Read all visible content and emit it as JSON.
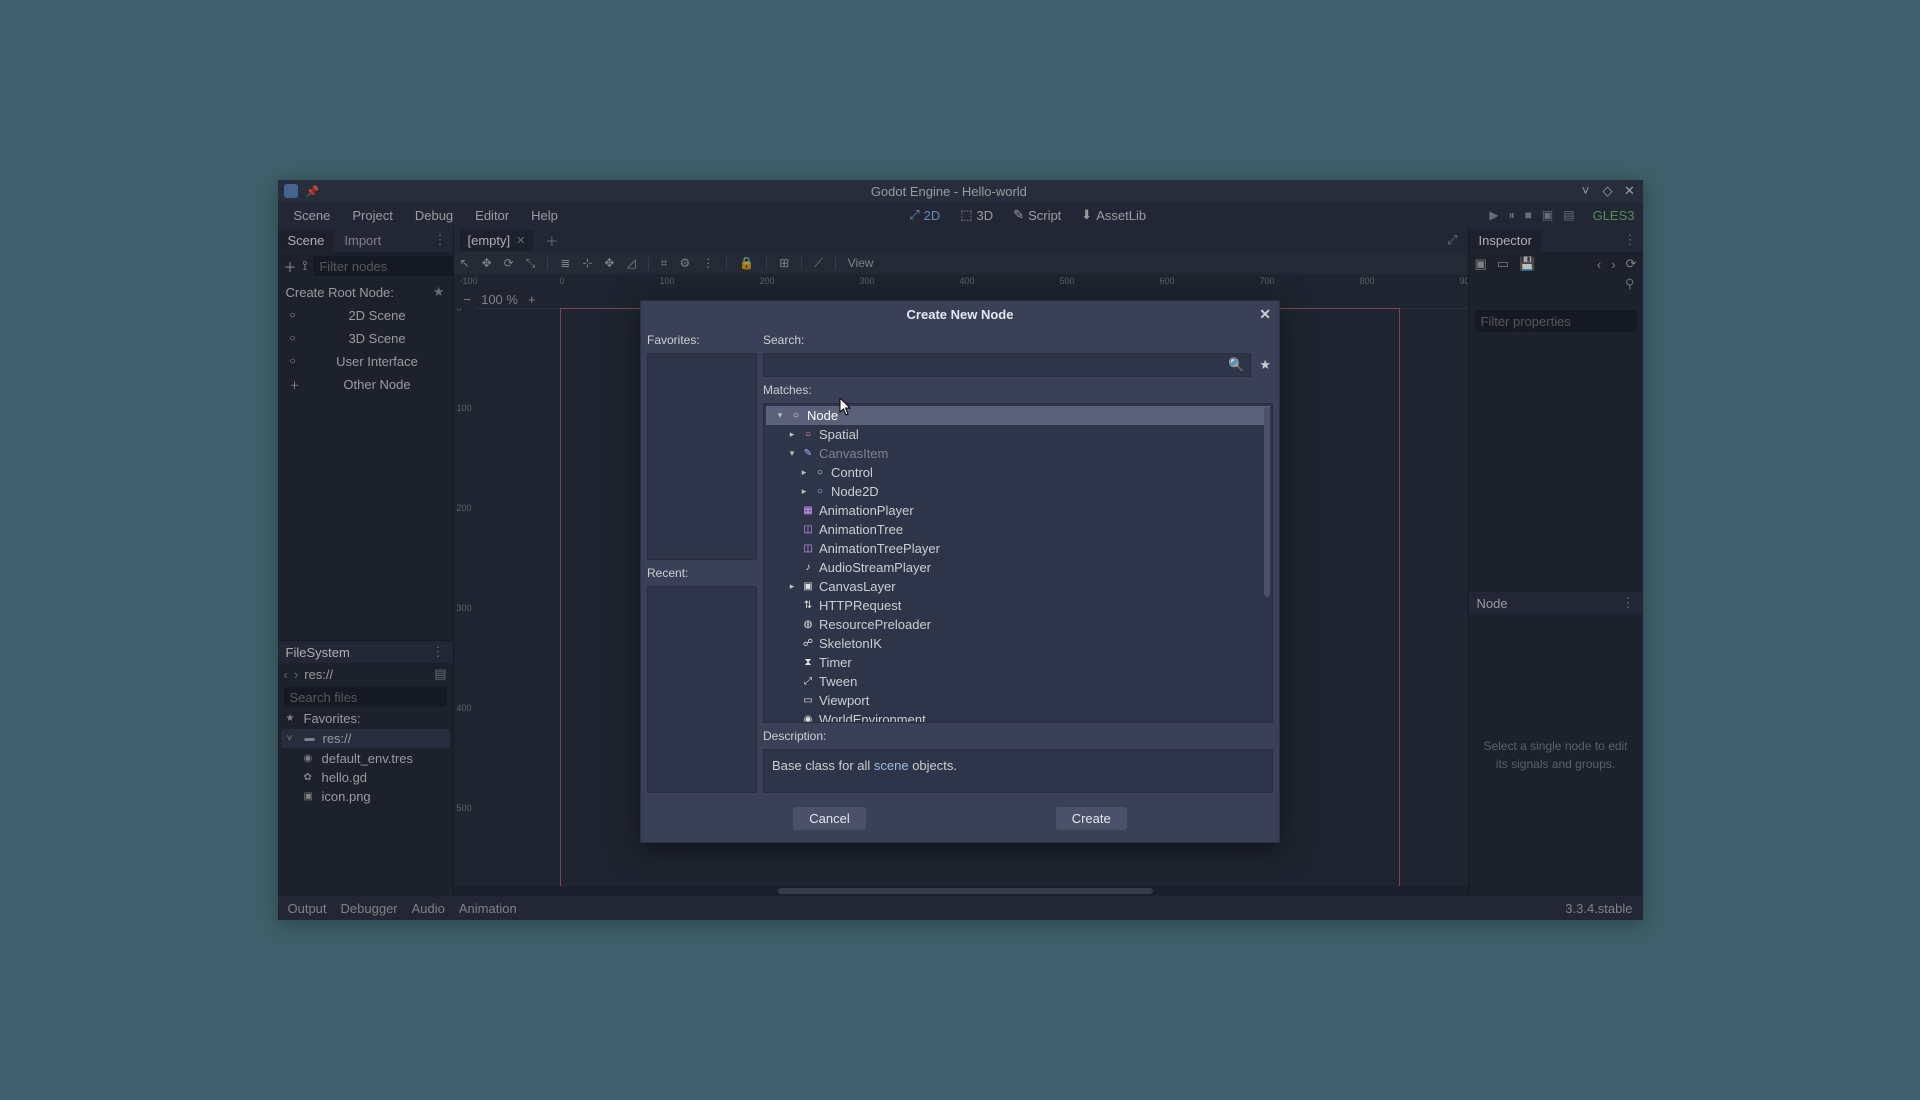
{
  "titlebar": {
    "title": "Godot Engine - Hello-world"
  },
  "menubar": {
    "items": [
      "Scene",
      "Project",
      "Debug",
      "Editor",
      "Help"
    ],
    "viewmodes": {
      "two_d": "2D",
      "three_d": "3D",
      "script": "Script",
      "assetlib": "AssetLib"
    },
    "gles": "GLES3"
  },
  "left": {
    "tabs": {
      "scene": "Scene",
      "import": "Import"
    },
    "filter_placeholder": "Filter nodes",
    "create_root": "Create Root Node:",
    "root_options": {
      "two_d": "2D Scene",
      "three_d": "3D Scene",
      "ui": "User Interface",
      "other": "Other Node"
    },
    "fs": {
      "title": "FileSystem",
      "path": "res://",
      "search_placeholder": "Search files",
      "favorites": "Favorites:",
      "res": "res://",
      "files": [
        "default_env.tres",
        "hello.gd",
        "icon.png"
      ]
    }
  },
  "center": {
    "tab": "[empty]",
    "view_label": "View",
    "zoom": "100 %"
  },
  "right": {
    "inspector": "Inspector",
    "filter_placeholder": "Filter properties",
    "node": "Node",
    "hint": "Select a single node to edit its signals and groups."
  },
  "bottom": {
    "items": [
      "Output",
      "Debugger",
      "Audio",
      "Animation"
    ],
    "version": "3.3.4.stable"
  },
  "dialog": {
    "title": "Create New Node",
    "favorites": "Favorites:",
    "recent": "Recent:",
    "search": "Search:",
    "matches": "Matches:",
    "description": "Description:",
    "desc_prefix": "Base class for all ",
    "desc_keyword": "scene",
    "desc_suffix": " objects.",
    "cancel": "Cancel",
    "create": "Create",
    "tree": [
      {
        "indent": 0,
        "caret": "v",
        "icon": "○",
        "iconColor": "#e0e0e0",
        "label": "Node",
        "sel": true
      },
      {
        "indent": 1,
        "caret": ">",
        "icon": "○",
        "iconColor": "#fc9c9c",
        "label": "Spatial"
      },
      {
        "indent": 1,
        "caret": "v",
        "icon": "✎",
        "iconColor": "#a5b7f3",
        "label": "CanvasItem",
        "dim": true
      },
      {
        "indent": 2,
        "caret": ">",
        "icon": "○",
        "iconColor": "#a5efac",
        "label": "Control"
      },
      {
        "indent": 2,
        "caret": ">",
        "icon": "○",
        "iconColor": "#a5b7f3",
        "label": "Node2D"
      },
      {
        "indent": 1,
        "caret": "",
        "icon": "▦",
        "iconColor": "#cf9cff",
        "label": "AnimationPlayer"
      },
      {
        "indent": 1,
        "caret": "",
        "icon": "◫",
        "iconColor": "#cf9cff",
        "label": "AnimationTree"
      },
      {
        "indent": 1,
        "caret": "",
        "icon": "◫",
        "iconColor": "#cf9cff",
        "label": "AnimationTreePlayer"
      },
      {
        "indent": 1,
        "caret": "",
        "icon": "♪",
        "iconColor": "#e0e0e0",
        "label": "AudioStreamPlayer"
      },
      {
        "indent": 1,
        "caret": ">",
        "icon": "▣",
        "iconColor": "#e0e0e0",
        "label": "CanvasLayer"
      },
      {
        "indent": 1,
        "caret": "",
        "icon": "⇅",
        "iconColor": "#e0e0e0",
        "label": "HTTPRequest"
      },
      {
        "indent": 1,
        "caret": "",
        "icon": "◍",
        "iconColor": "#e0e0e0",
        "label": "ResourcePreloader"
      },
      {
        "indent": 1,
        "caret": "",
        "icon": "☍",
        "iconColor": "#e0e0e0",
        "label": "SkeletonIK"
      },
      {
        "indent": 1,
        "caret": "",
        "icon": "⧗",
        "iconColor": "#e0e0e0",
        "label": "Timer"
      },
      {
        "indent": 1,
        "caret": "",
        "icon": "⤢",
        "iconColor": "#e0e0e0",
        "label": "Tween"
      },
      {
        "indent": 1,
        "caret": "",
        "icon": "▭",
        "iconColor": "#e0e0e0",
        "label": "Viewport"
      },
      {
        "indent": 1,
        "caret": "",
        "icon": "◉",
        "iconColor": "#e0e0e0",
        "label": "WorldEnvironment"
      }
    ]
  }
}
